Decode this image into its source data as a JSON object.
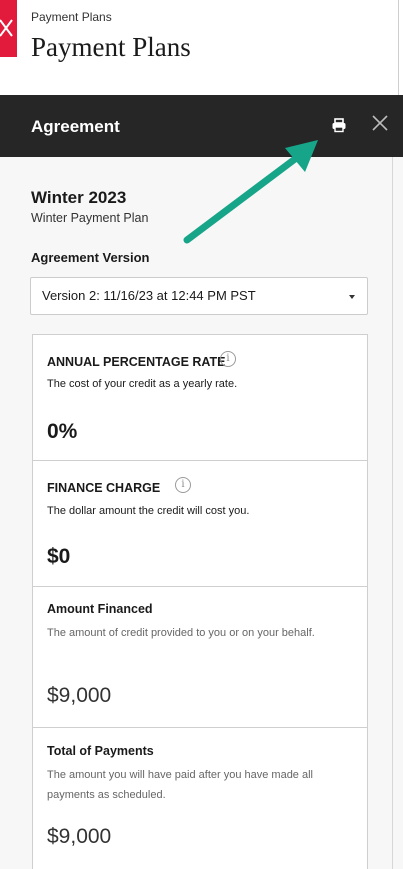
{
  "header": {
    "breadcrumb": "Payment Plans",
    "title": "Payment Plans"
  },
  "agreement_bar": {
    "title": "Agreement",
    "print_icon": "printer-icon",
    "close_icon": "close-icon"
  },
  "plan": {
    "term": "Winter 2023",
    "name": "Winter Payment Plan"
  },
  "version": {
    "label": "Agreement Version",
    "selected": "Version 2: 11/16/23 at 12:44 PM PST"
  },
  "disclosures": {
    "apr": {
      "heading": "ANNUAL PERCENTAGE RATE",
      "description": "The cost of your credit as a yearly rate.",
      "value": "0%"
    },
    "finance_charge": {
      "heading": "FINANCE CHARGE",
      "description": "The dollar amount the credit will cost you.",
      "value": "$0"
    },
    "amount_financed": {
      "heading": "Amount Financed",
      "description": "The amount of credit provided to you or on your behalf.",
      "value": "$9,000"
    },
    "total_payments": {
      "heading": "Total of Payments",
      "description": "The amount you will have paid after you have made all payments as scheduled.",
      "value": "$9,000"
    }
  },
  "colors": {
    "accent_red": "#e21b3c",
    "bar_dark": "#262626",
    "annotation_arrow": "#17a589"
  }
}
